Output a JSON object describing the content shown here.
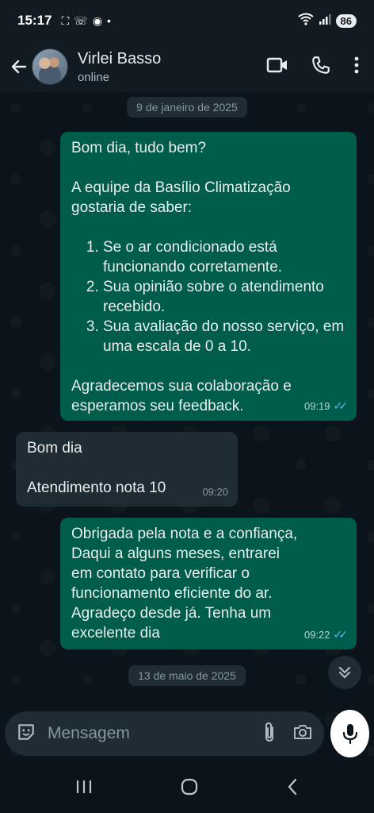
{
  "status_bar": {
    "time": "15:17",
    "battery": "86"
  },
  "header": {
    "contact_name": "Virlei Basso",
    "contact_status": "online"
  },
  "messages": [
    {
      "type": "date",
      "text": "9 de janeiro de 2025"
    },
    {
      "type": "outgoing",
      "greeting": "Bom dia, tudo bem?",
      "intro": "A equipe da Basílio Climatização gostaria de saber:",
      "list": [
        "Se o ar condicionado está funcionando corretamente.",
        "Sua opinião sobre o atendimento recebido.",
        "Sua avaliação do nosso serviço, em uma escala de 0 a 10."
      ],
      "closing": "Agradecemos sua colaboração e esperamos seu feedback.",
      "time": "09:19"
    },
    {
      "type": "incoming",
      "line1": "Bom dia",
      "line2": "Atendimento nota 10",
      "time": "09:20"
    },
    {
      "type": "outgoing",
      "text": "Obrigada pela nota e a confiança, Daqui a alguns meses, entrarei em contato para verificar o funcionamento eficiente do ar. Agradeço desde já. Tenha um excelente dia",
      "time": "09:22"
    },
    {
      "type": "date",
      "text": "13 de maio de 2025"
    }
  ],
  "composer": {
    "placeholder": "Mensagem"
  },
  "icons": {
    "back": "arrow-left-icon",
    "video": "video-camera-icon",
    "call": "phone-icon",
    "menu": "more-vertical-icon",
    "emoji": "sticker-icon",
    "attach": "paperclip-icon",
    "camera": "camera-icon",
    "mic": "microphone-icon",
    "scroll": "double-chevron-down-icon"
  },
  "colors": {
    "outgoing_bubble": "#005c4b",
    "incoming_bubble": "#202c33",
    "read_ticks": "#53bdeb",
    "background": "#0b141a"
  }
}
